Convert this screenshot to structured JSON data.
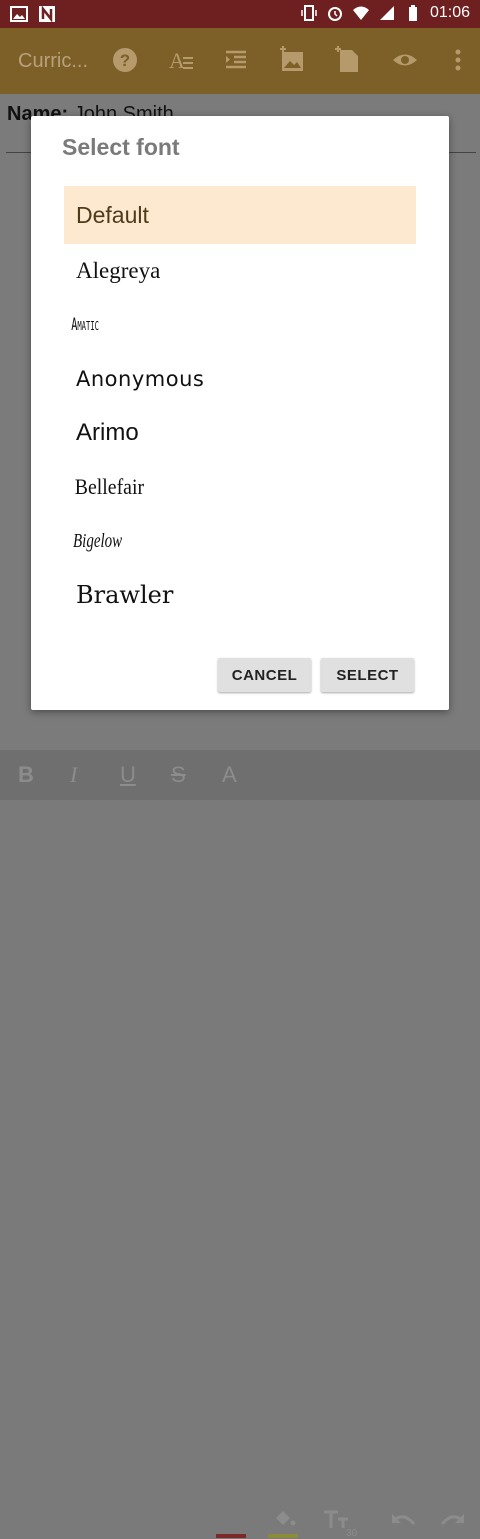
{
  "status_bar": {
    "time": "01:06",
    "left_icons": [
      "image-icon",
      "n-notification-icon"
    ],
    "right_icons": [
      "vibrate-icon",
      "alarm-icon",
      "wifi-icon",
      "signal-icon",
      "battery-icon"
    ]
  },
  "toolbar": {
    "title": "Curric...",
    "icons": [
      "help-icon",
      "font-style-icon",
      "list-indent-icon",
      "add-image-icon",
      "add-page-icon",
      "preview-eye-icon",
      "more-vert-icon"
    ]
  },
  "document": {
    "name_label": "Name:",
    "name_value": "John Smith"
  },
  "dialog": {
    "title": "Select font",
    "fonts": [
      "Default",
      "Alegreya",
      "Amatic",
      "Anonymous",
      "Arimo",
      "Bellefair",
      "Bigelow",
      "Brawler"
    ],
    "selected_font": "Default",
    "cancel_label": "CANCEL",
    "select_label": "SELECT"
  },
  "bottom_bar": {
    "items": [
      "B",
      "I",
      "U",
      "S",
      "A",
      "fill-icon",
      "text-size-icon",
      "undo-icon",
      "redo-icon"
    ],
    "text_size_value": "30",
    "font_color": "#b71c1c",
    "fill_color": "#c0ca33"
  }
}
